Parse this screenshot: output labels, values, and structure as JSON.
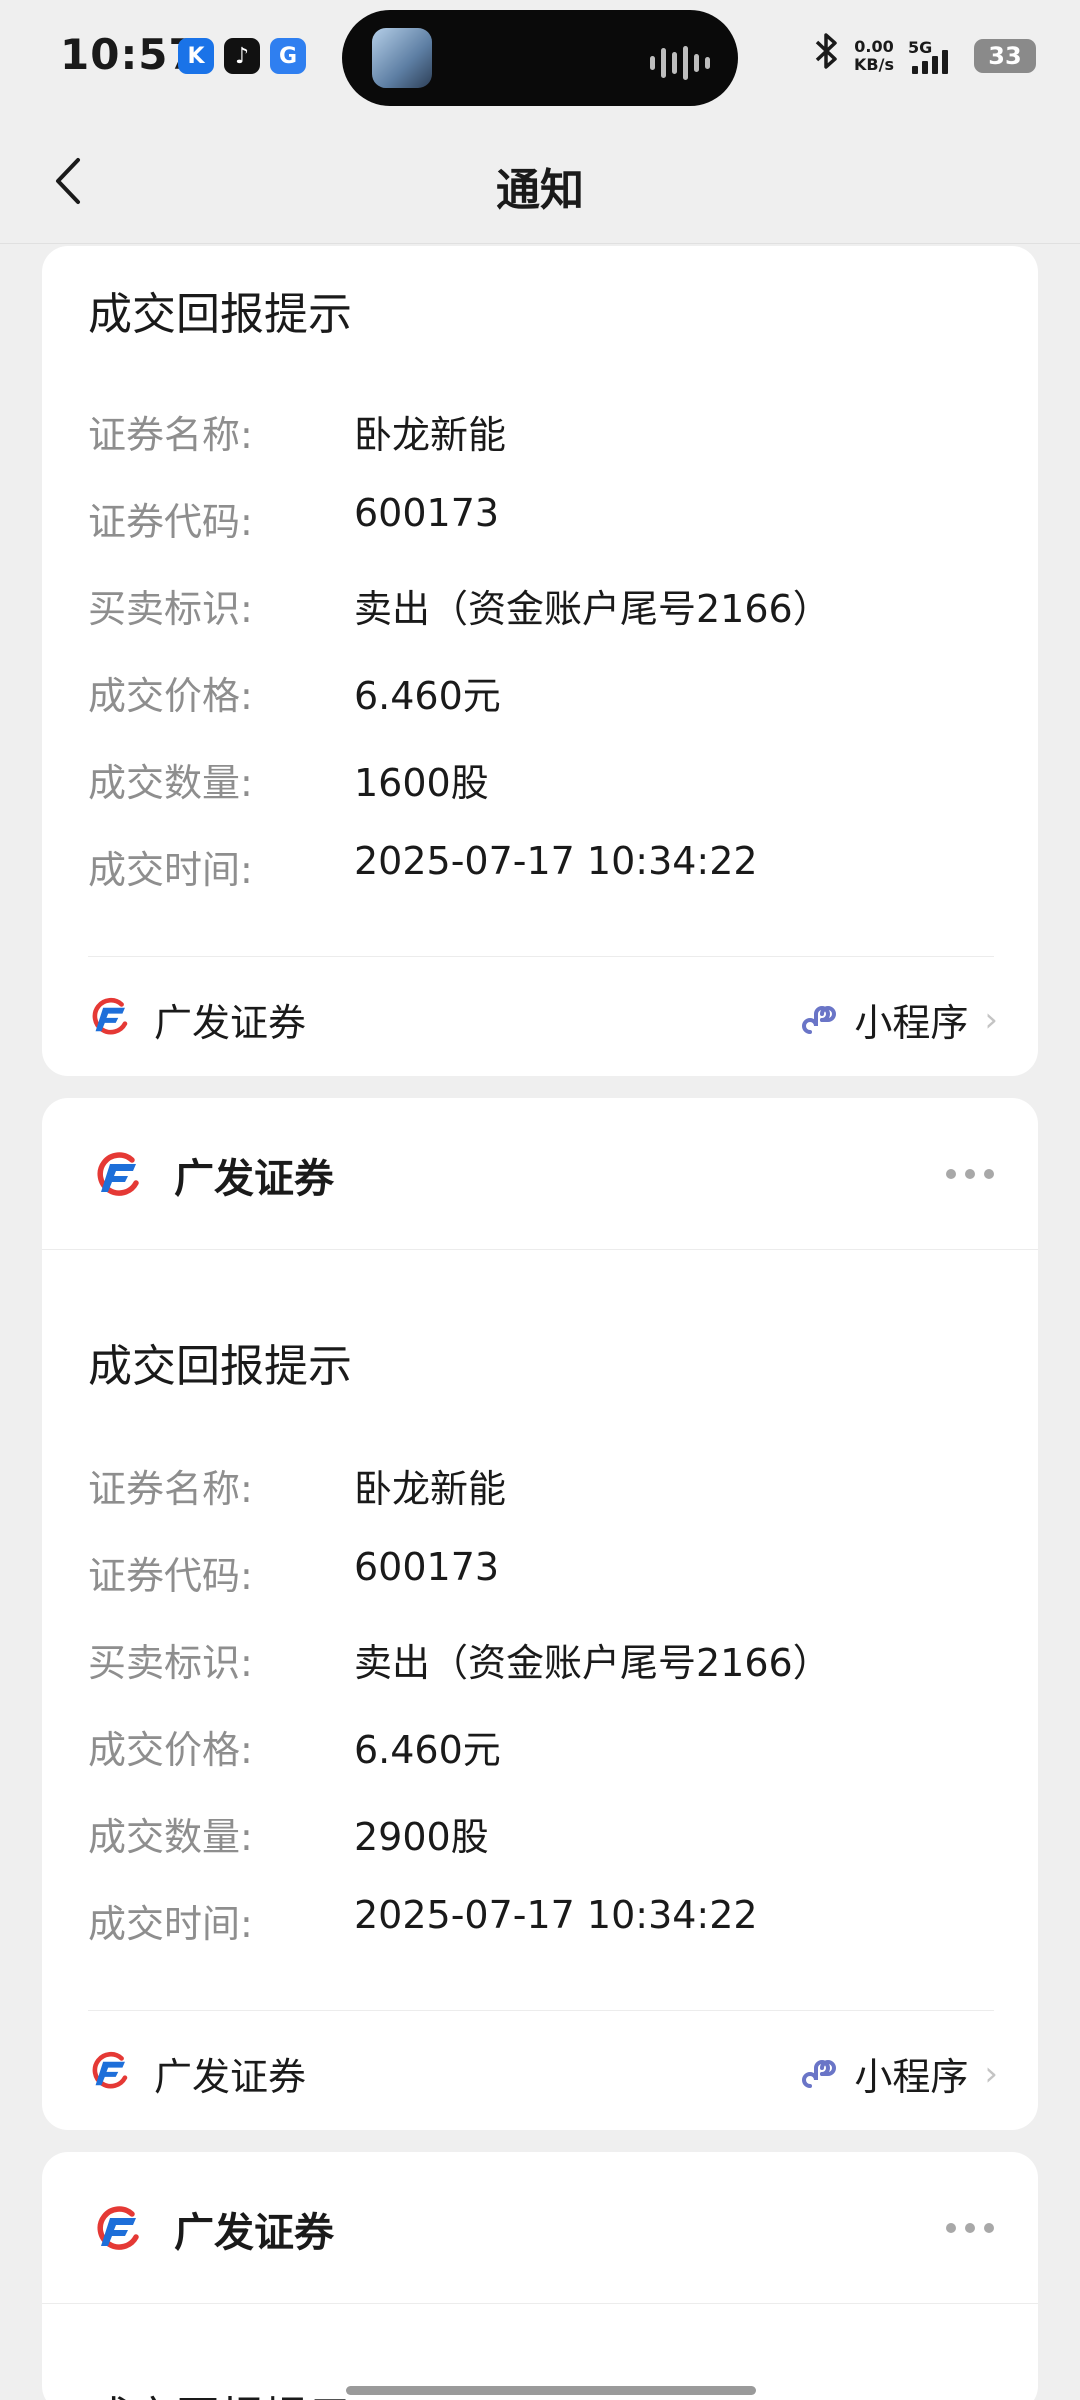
{
  "status_bar": {
    "time": "10:57",
    "app_icons": [
      "K",
      "♪",
      "G"
    ],
    "net_speed_value": "0.00",
    "net_speed_unit": "KB/s",
    "network": "5G",
    "battery": "33"
  },
  "nav": {
    "title": "通知"
  },
  "brand": {
    "name": "广发证券",
    "accent_red": "#e53935",
    "accent_blue": "#1e6fd9"
  },
  "mini_program_label": "小程序",
  "notifications": [
    {
      "title": "成交回报提示",
      "fields": [
        {
          "label": "证券名称:",
          "value": "卧龙新能"
        },
        {
          "label": "证券代码:",
          "value": "600173"
        },
        {
          "label": "买卖标识:",
          "value": "卖出（资金账户尾号2166）"
        },
        {
          "label": "成交价格:",
          "value": "6.460元"
        },
        {
          "label": "成交数量:",
          "value": "1600股"
        },
        {
          "label": "成交时间:",
          "value": "2025-07-17 10:34:22"
        }
      ],
      "footer_brand": "广发证券"
    },
    {
      "header_brand": "广发证券",
      "title": "成交回报提示",
      "fields": [
        {
          "label": "证券名称:",
          "value": "卧龙新能"
        },
        {
          "label": "证券代码:",
          "value": "600173"
        },
        {
          "label": "买卖标识:",
          "value": "卖出（资金账户尾号2166）"
        },
        {
          "label": "成交价格:",
          "value": "6.460元"
        },
        {
          "label": "成交数量:",
          "value": "2900股"
        },
        {
          "label": "成交时间:",
          "value": "2025-07-17 10:34:22"
        }
      ],
      "footer_brand": "广发证券"
    },
    {
      "header_brand": "广发证券",
      "title": "成交回报提示"
    }
  ]
}
